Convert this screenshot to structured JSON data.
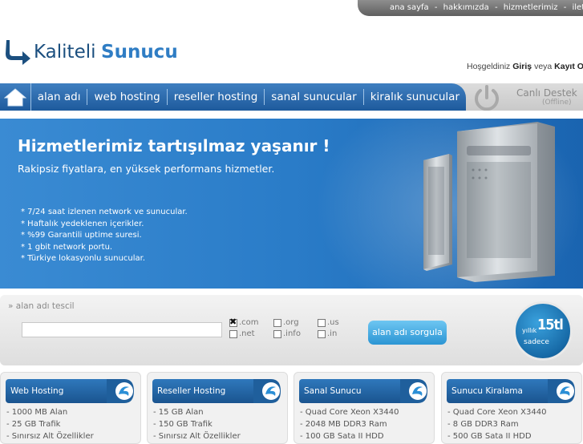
{
  "top_links": [
    "ana sayfa",
    "hakkımızda",
    "hizmetlerimiz",
    "iletişim"
  ],
  "top_separator": "-",
  "logo": {
    "part1": "Kaliteli",
    "part2": "Sunucu"
  },
  "welcome": {
    "text": "Hoşgeldiniz",
    "login": "Giriş",
    "or": "veya",
    "register": "Kayıt Ol"
  },
  "nav": {
    "home_icon": "home-icon",
    "items": [
      "alan adı",
      "web hosting",
      "reseller hosting",
      "sanal sunucular",
      "kiralık sunucular"
    ]
  },
  "support": {
    "title": "Canlı Destek",
    "status": "(Offline)",
    "icon": "power-icon"
  },
  "banner": {
    "title": "Hizmetlerimiz tartışılmaz yaşanır !",
    "subtitle": "Rakipsiz fiyatlara, en yüksek performans hizmetler.",
    "features": [
      "* 7/24 saat izlenen network ve sunucular.",
      "* Haftalık yedeklenen içerikler.",
      "* %99 Garantili uptime suresi.",
      "* 1 gbit network portu.",
      "* Türkiye lokasyonlu sunucular."
    ]
  },
  "domain": {
    "label": "» alan adı tescil",
    "input_value": "",
    "tlds": [
      {
        "name": ".com",
        "checked": true
      },
      {
        "name": ".org",
        "checked": false
      },
      {
        "name": ".us",
        "checked": false
      },
      {
        "name": ".net",
        "checked": false
      },
      {
        "name": ".info",
        "checked": false
      },
      {
        "name": ".in",
        "checked": false
      }
    ],
    "button": "alan adı sorgula",
    "promo": {
      "yillik": "yıllık",
      "price": "15tl",
      "sadece": "sadece"
    }
  },
  "products": [
    {
      "title": "Web Hosting",
      "lines": [
        "- 1000 MB Alan",
        "- 25 GB Trafik",
        "- Sınırsız Alt Özellikler"
      ]
    },
    {
      "title": "Reseller Hosting",
      "lines": [
        "- 15 GB Alan",
        "- 150 GB Trafik",
        "- Sınırsız Alt Özellikler"
      ]
    },
    {
      "title": "Sanal Sunucu",
      "lines": [
        "- Quad Core Xeon X3440",
        "- 2048 MB DDR3 Ram",
        "- 100 GB Sata II HDD"
      ]
    },
    {
      "title": "Sunucu Kiralama",
      "lines": [
        "- Quad Core Xeon X3440",
        "- 8 GB DDR3 Ram",
        "- 500 GB Sata II HDD"
      ]
    }
  ],
  "colors": {
    "primary_blue": "#2a6fb2",
    "banner_blue": "#2a7cc8",
    "button_blue": "#2b95d4"
  }
}
